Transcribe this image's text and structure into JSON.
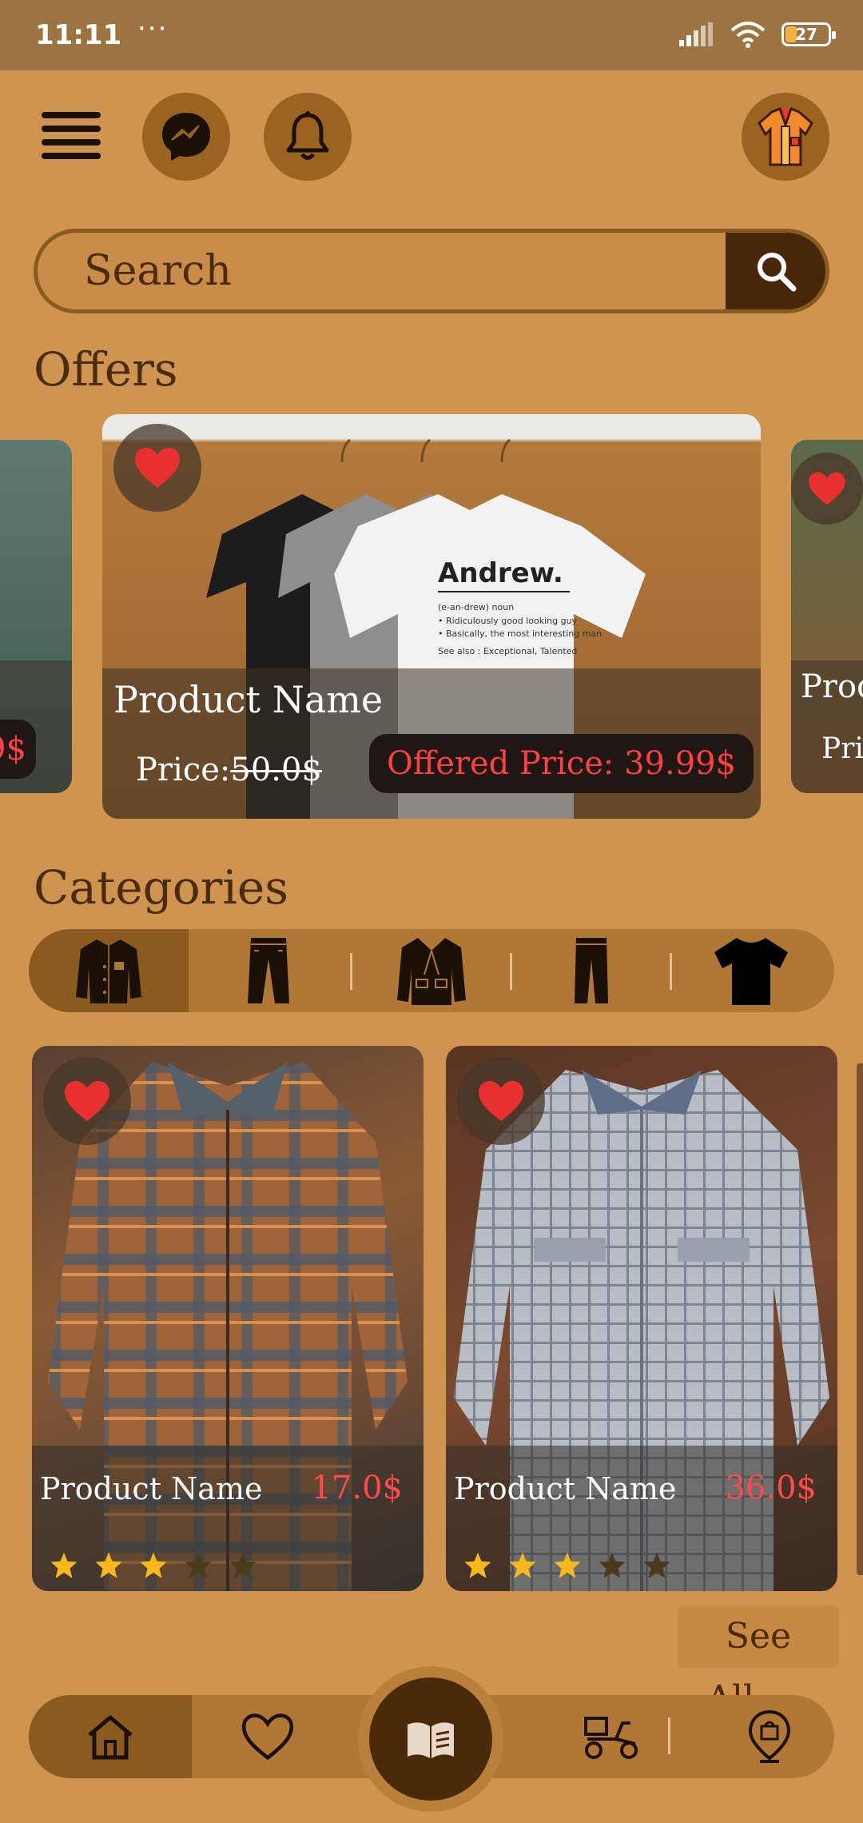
{
  "status_bar": {
    "time": "11:11",
    "dots": "···",
    "battery": "27",
    "battery_level": 0.27
  },
  "search": {
    "placeholder": "Search"
  },
  "sections": {
    "offers": "Offers",
    "categories": "Categories"
  },
  "offers": [
    {
      "name": "",
      "price_fragment": "9$"
    },
    {
      "name": "Product Name",
      "price_label": "Price:",
      "old_price": "50.0$",
      "offered_price": "Offered Price: 39.99$"
    },
    {
      "name": "Prod",
      "price_fragment": "Pric"
    }
  ],
  "categories": [
    {
      "icon": "jacket-icon",
      "active": true
    },
    {
      "icon": "pants-icon",
      "active": false
    },
    {
      "icon": "coat-icon",
      "active": false
    },
    {
      "icon": "jeans-icon",
      "active": false
    },
    {
      "icon": "tshirt-icon",
      "active": false
    }
  ],
  "products": [
    {
      "name": "Product Name",
      "price": "17.0$",
      "rating": 3,
      "max_rating": 5
    },
    {
      "name": "Product Name",
      "price": "36.0$",
      "rating": 3,
      "max_rating": 5
    }
  ],
  "see_all": "See All.....",
  "bottom_nav": [
    {
      "icon": "home-icon",
      "active": true
    },
    {
      "icon": "heart-icon",
      "active": false
    },
    {
      "icon": "catalog-icon",
      "active": false
    },
    {
      "icon": "delivery-scooter-icon",
      "active": false
    },
    {
      "icon": "location-bag-icon",
      "active": false
    }
  ],
  "colors": {
    "background": "#cf944f",
    "dark_brown": "#472708",
    "accent_red": "#ff4040",
    "star": "#f6b81d"
  }
}
